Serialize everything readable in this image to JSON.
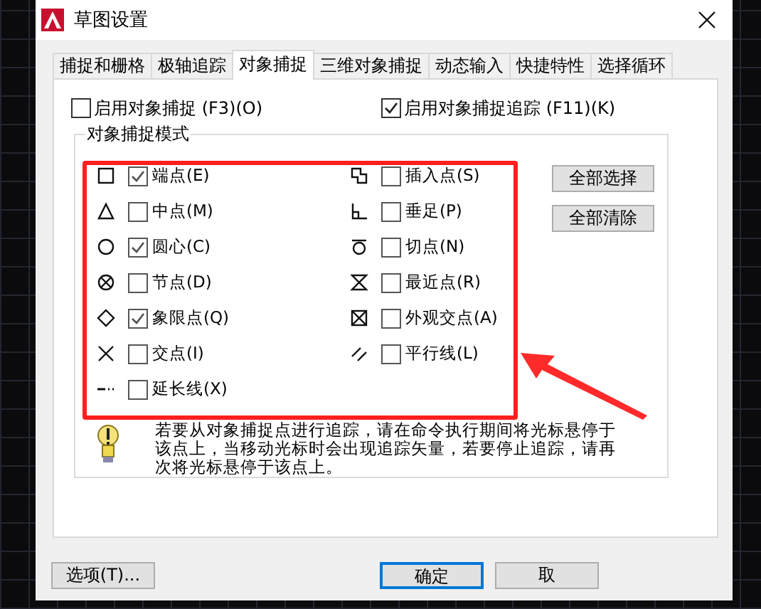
{
  "window": {
    "title": "草图设置"
  },
  "tabs": [
    {
      "label": "捕捉和栅格",
      "selected": false
    },
    {
      "label": "极轴追踪",
      "selected": false
    },
    {
      "label": "对象捕捉",
      "selected": true
    },
    {
      "label": "三维对象捕捉",
      "selected": false
    },
    {
      "label": "动态输入",
      "selected": false
    },
    {
      "label": "快捷特性",
      "selected": false
    },
    {
      "label": "选择循环",
      "selected": false
    }
  ],
  "options": [
    {
      "label": "启用对象捕捉 (F3)(O)",
      "checked": false
    },
    {
      "label": "启用对象捕捉追踪 (F11)(K)",
      "checked": true
    }
  ],
  "snap_modes": {
    "title": "对象捕捉模式",
    "columns": [
      [
        {
          "label": "端点(E)",
          "checked": true
        },
        {
          "label": "中点(M)",
          "checked": false
        },
        {
          "label": "圆心(C)",
          "checked": true
        },
        {
          "label": "节点(D)",
          "checked": false
        },
        {
          "label": "象限点(Q)",
          "checked": true
        },
        {
          "label": "交点(I)",
          "checked": false
        },
        {
          "label": "延长线(X)",
          "checked": false
        }
      ],
      [
        {
          "label": "插入点(S)",
          "checked": false
        },
        {
          "label": "垂足(P)",
          "checked": false
        },
        {
          "label": "切点(N)",
          "checked": false
        },
        {
          "label": "最近点(R)",
          "checked": false
        },
        {
          "label": "外观交点(A)",
          "checked": false
        },
        {
          "label": "平行线(L)",
          "checked": false
        }
      ]
    ],
    "buttons": [
      "全部选择",
      "全部清除"
    ],
    "tip": "若要从对象捕捉点进行追踪，请在命令执行期间将光标悬停于该点上，当移动光标时会出现追踪矢量，若要停止追踪，请再次将光标悬停于该点上。"
  },
  "buttons": [
    {
      "label": "选项(T)...",
      "focused": false
    },
    {
      "label": "确定",
      "focused": true
    },
    {
      "label": "取",
      "focused": false
    }
  ]
}
